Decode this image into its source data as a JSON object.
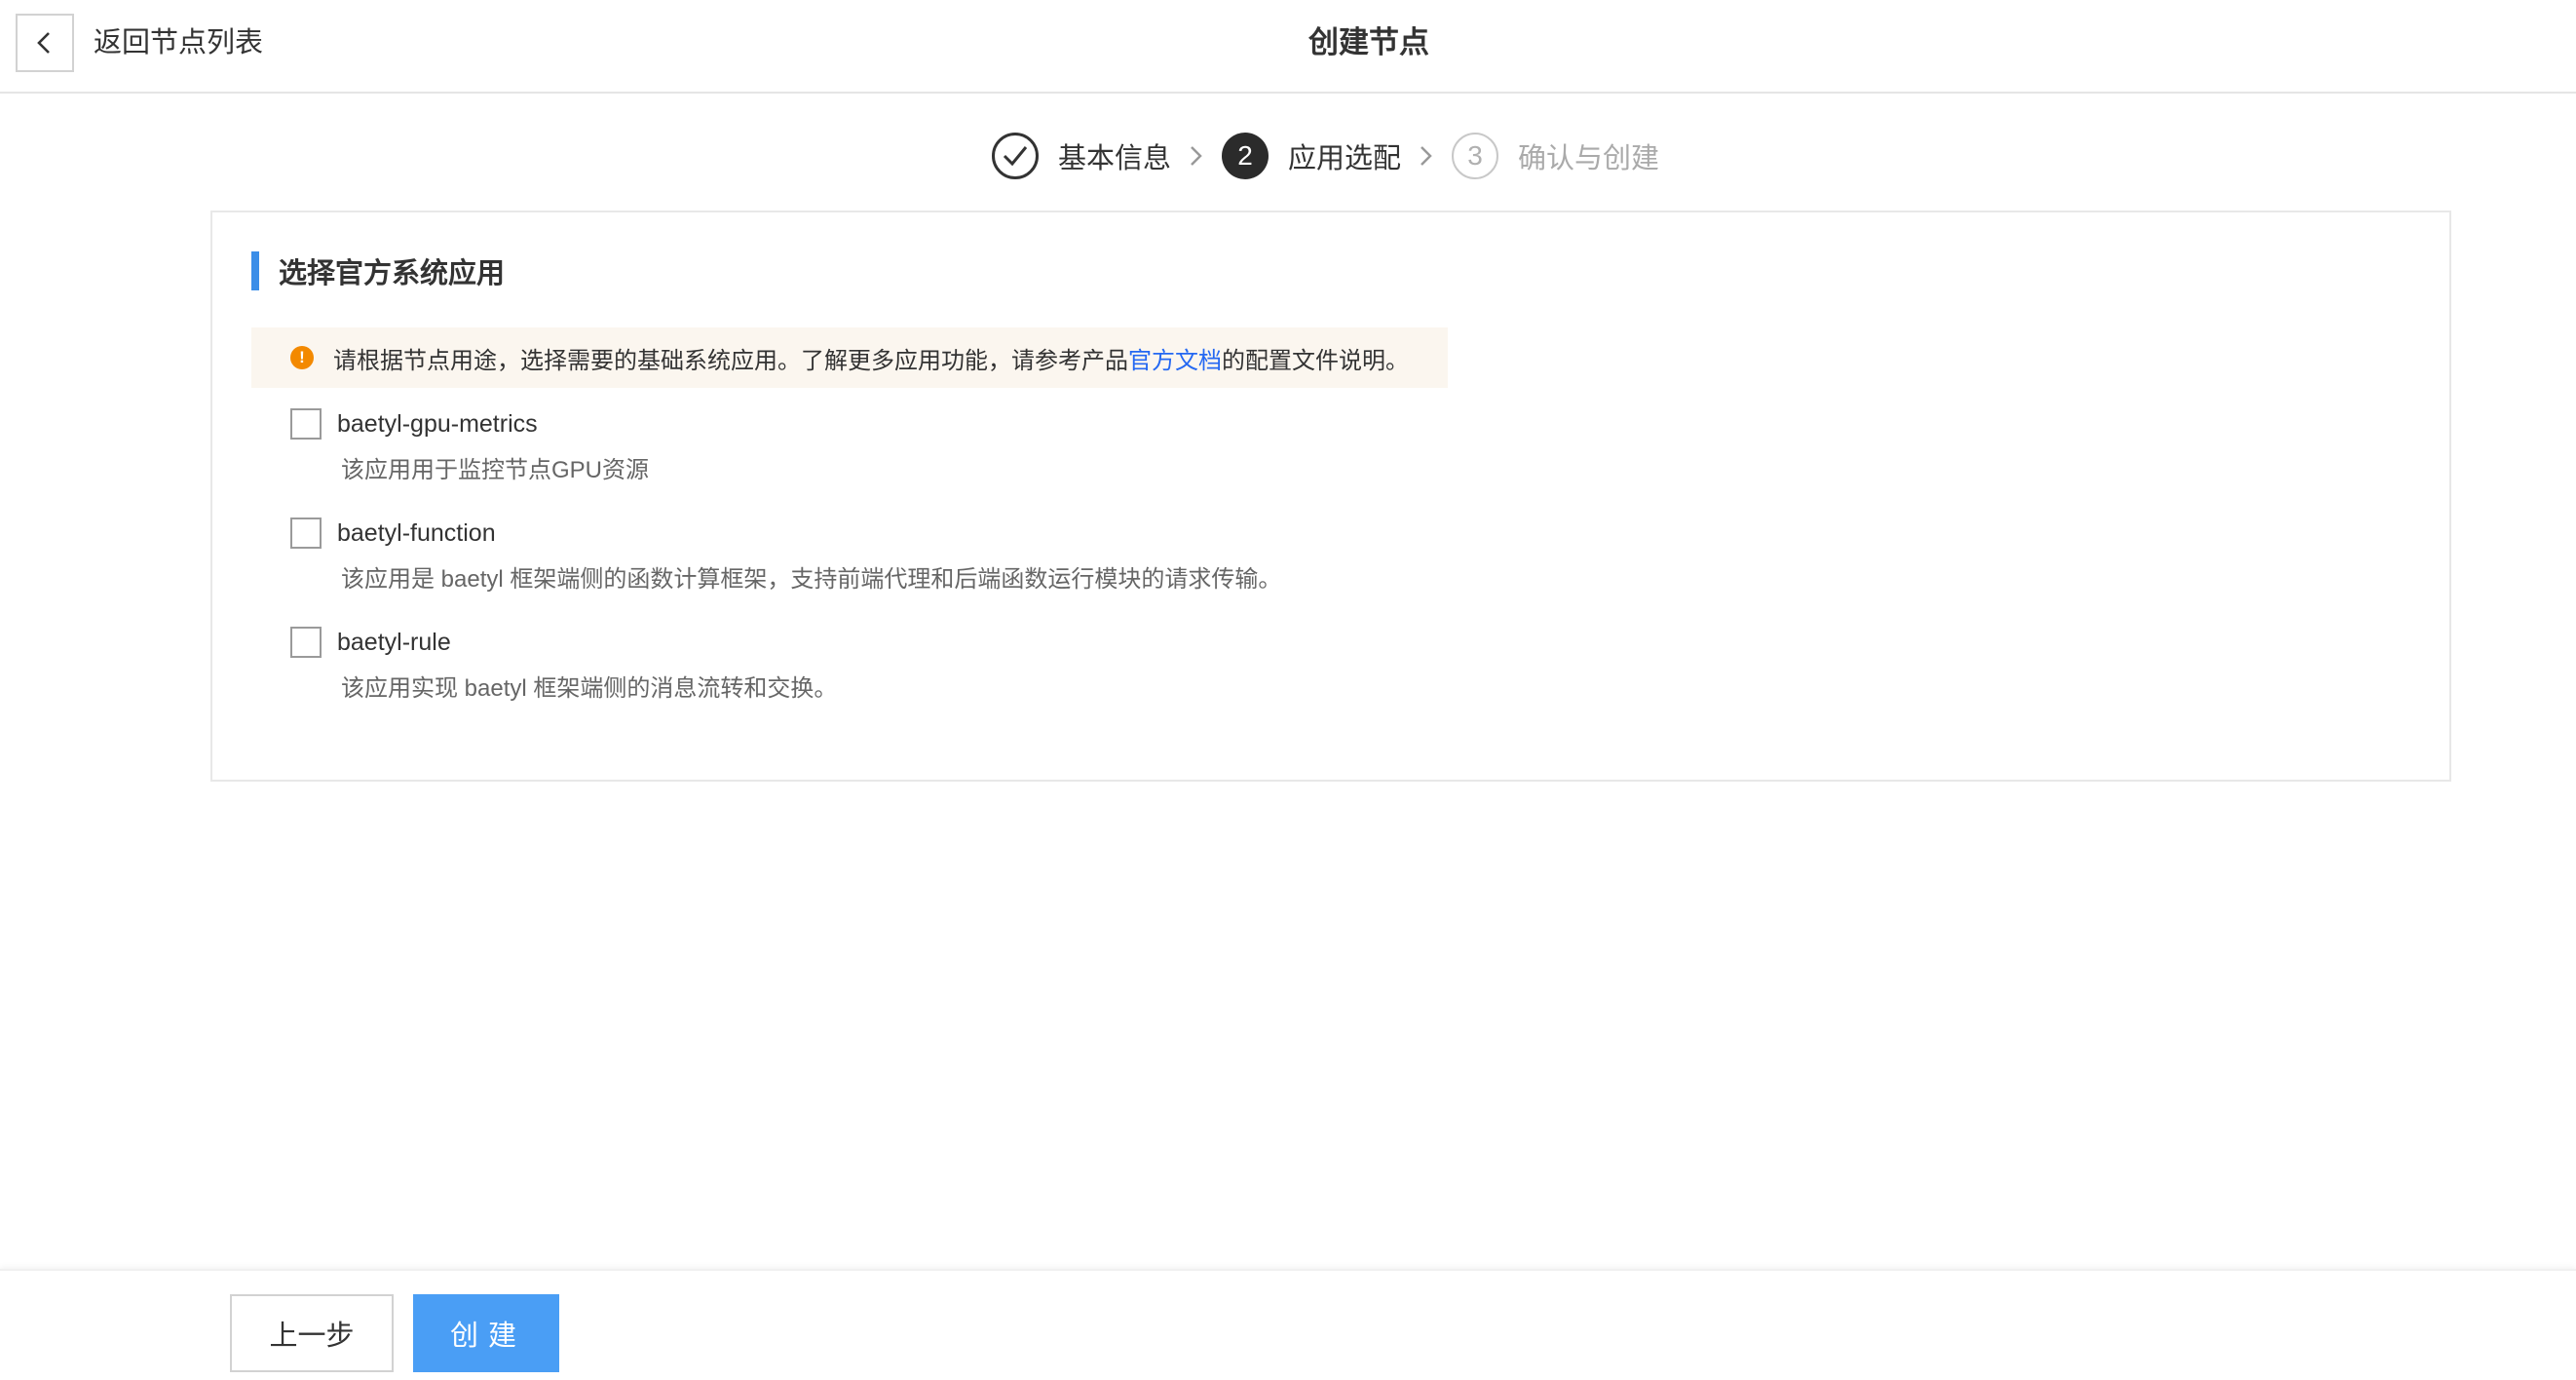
{
  "header": {
    "back_label": "返回节点列表",
    "title": "创建节点"
  },
  "steps": [
    {
      "index": "1",
      "label": "基本信息",
      "status": "done"
    },
    {
      "index": "2",
      "label": "应用选配",
      "status": "active"
    },
    {
      "index": "3",
      "label": "确认与创建",
      "status": "todo"
    }
  ],
  "section": {
    "title": "选择官方系统应用",
    "alert": {
      "icon": "!",
      "text_before": "请根据节点用途，选择需要的基础系统应用。了解更多应用功能，请参考产品",
      "link": "官方文档",
      "text_after": "的配置文件说明。"
    },
    "options": [
      {
        "name": "baetyl-gpu-metrics",
        "description": "该应用用于监控节点GPU资源",
        "checked": false
      },
      {
        "name": "baetyl-function",
        "description": "该应用是 baetyl 框架端侧的函数计算框架，支持前端代理和后端函数运行模块的请求传输。",
        "checked": false
      },
      {
        "name": "baetyl-rule",
        "description": "该应用实现 baetyl 框架端侧的消息流转和交换。",
        "checked": false
      }
    ]
  },
  "footer": {
    "prev_label": "上一步",
    "create_label": "创建"
  },
  "colors": {
    "accent": "#4a9ef5",
    "link": "#2468f2",
    "warning": "#f38900",
    "alert_bg": "#fbf6ef"
  }
}
